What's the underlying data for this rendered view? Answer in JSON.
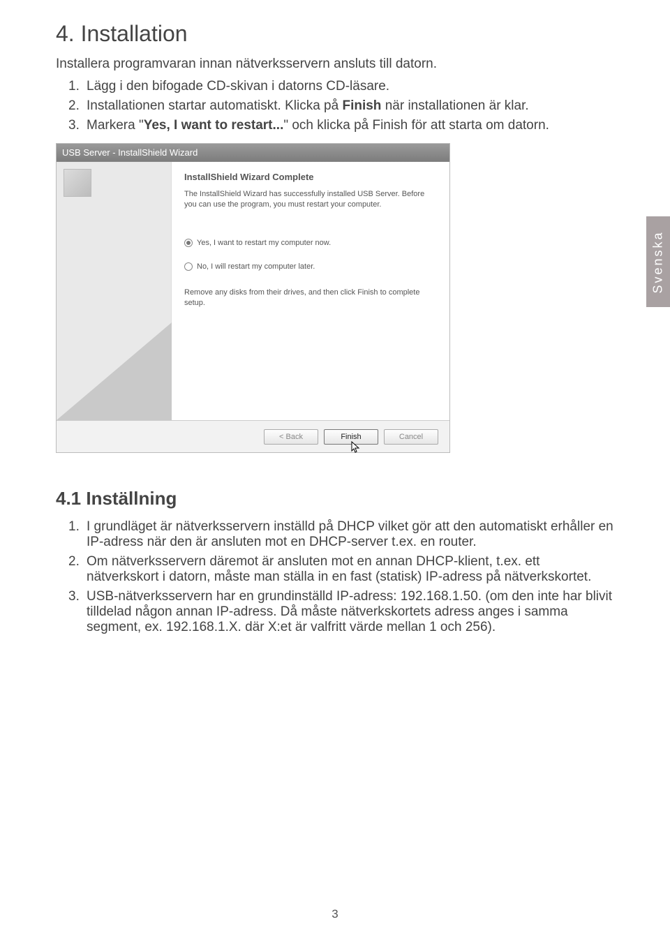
{
  "h1": "4. Installation",
  "intro": "Installera programvaran innan nätverksservern ansluts till datorn.",
  "steps1": [
    {
      "n": "1.",
      "text": "Lägg i den bifogade CD-skivan i datorns CD-läsare."
    },
    {
      "n": "2.",
      "text_pre": "Installationen startar automatiskt. Klicka på ",
      "bold": "Finish",
      "text_post": " när installationen är klar."
    },
    {
      "n": "3.",
      "text_pre": "Markera \"",
      "bold": "Yes, I want to restart...",
      "text_post": "\" och klicka på Finish för att starta om datorn."
    }
  ],
  "side_tab": "Svenska",
  "wizard": {
    "title": "USB Server - InstallShield Wizard",
    "complete": "InstallShield Wizard Complete",
    "para1": "The InstallShield Wizard has successfully installed USB Server.  Before you can use the program, you must restart your computer.",
    "radio_yes": "Yes, I want to restart my computer now.",
    "radio_no": "No, I will restart my computer later.",
    "para2": "Remove any disks from their drives, and then click Finish to complete setup.",
    "btn_back": "< Back",
    "btn_finish": "Finish",
    "btn_cancel": "Cancel"
  },
  "h2": "4.1 Inställning",
  "steps2": [
    {
      "n": "1.",
      "text": "I grundläget är nätverksservern inställd på DHCP vilket gör att den automatiskt erhåller en IP-adress när den är ansluten mot en DHCP-server t.ex. en router."
    },
    {
      "n": "2.",
      "text": "Om nätverksservern däremot är ansluten mot en annan DHCP-klient, t.ex. ett nätverkskort i datorn, måste man ställa in en fast (statisk) IP-adress på nätverkskortet."
    },
    {
      "n": "3.",
      "text": "USB-nätverksservern har en grundinställd IP-adress: 192.168.1.50. (om den inte har blivit tilldelad någon annan IP-adress. Då måste nätverkskortets adress anges i samma segment, ex. 192.168.1.X. där X:et är valfritt värde mellan 1 och 256)."
    }
  ],
  "page_number": "3"
}
